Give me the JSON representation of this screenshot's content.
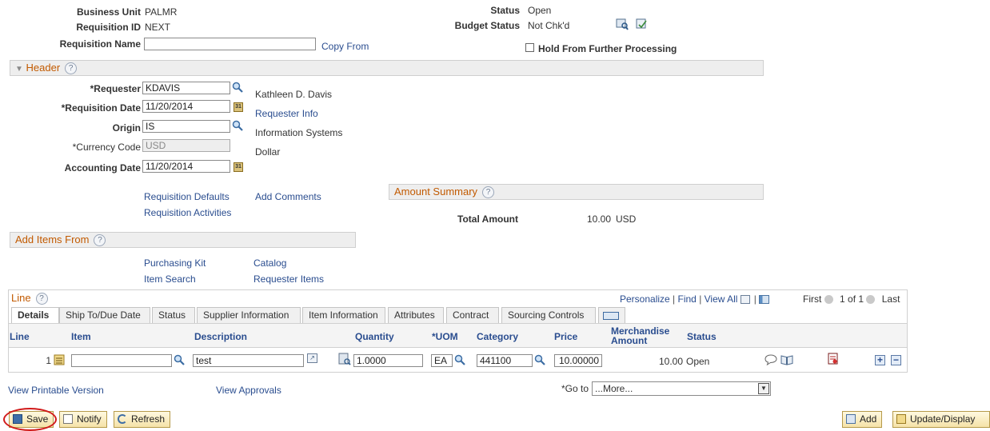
{
  "summary": {
    "business_unit_label": "Business Unit",
    "business_unit_value": "PALMR",
    "requisition_id_label": "Requisition ID",
    "requisition_id_value": "NEXT",
    "requisition_name_label": "Requisition Name",
    "requisition_name_value": "",
    "copy_from_link": "Copy From",
    "status_label": "Status",
    "status_value": "Open",
    "budget_status_label": "Budget Status",
    "budget_status_value": "Not Chk'd",
    "hold_label": "Hold From Further Processing"
  },
  "header": {
    "title": "Header",
    "requester_label": "*Requester",
    "requester_value": "KDAVIS",
    "requester_name": "Kathleen D. Davis",
    "req_date_label": "*Requisition Date",
    "req_date_value": "11/20/2014",
    "requester_info_link": "Requester Info",
    "origin_label": "Origin",
    "origin_value": "IS",
    "origin_desc": "Information Systems",
    "currency_label": "*Currency Code",
    "currency_value": "USD",
    "currency_desc": "Dollar",
    "acct_date_label": "Accounting Date",
    "acct_date_value": "11/20/2014",
    "req_defaults_link": "Requisition Defaults",
    "add_comments_link": "Add Comments",
    "req_activities_link": "Requisition Activities"
  },
  "amount_summary": {
    "title": "Amount Summary",
    "total_label": "Total Amount",
    "total_value": "10.00",
    "currency": "USD"
  },
  "add_items": {
    "title": "Add Items From",
    "purchasing_kit": "Purchasing Kit",
    "catalog": "Catalog",
    "item_search": "Item Search",
    "requester_items": "Requester Items"
  },
  "line_grid": {
    "title": "Line",
    "personalize": "Personalize",
    "find": "Find",
    "view_all": "View All",
    "first": "First",
    "pager": "1 of 1",
    "last": "Last",
    "tabs": [
      "Details",
      "Ship To/Due Date",
      "Status",
      "Supplier Information",
      "Item Information",
      "Attributes",
      "Contract",
      "Sourcing Controls"
    ],
    "columns": [
      "Line",
      "Item",
      "Description",
      "Quantity",
      "*UOM",
      "Category",
      "Price",
      "Merchandise Amount",
      "Status"
    ],
    "rows": [
      {
        "line": "1",
        "item": "",
        "description": "test",
        "quantity": "1.0000",
        "uom": "EA",
        "category": "441100",
        "price": "10.00000",
        "merch_amount": "10.00",
        "status": "Open"
      }
    ]
  },
  "footer": {
    "view_printable": "View Printable Version",
    "view_approvals": "View Approvals",
    "goto_label": "*Go to",
    "goto_value": "...More..."
  },
  "buttons": {
    "save": "Save",
    "notify": "Notify",
    "refresh": "Refresh",
    "add": "Add",
    "update_display": "Update/Display"
  },
  "colors": {
    "section_title": "#c25a00",
    "link": "#2a4d8f",
    "highlight_circle": "#d11a1a"
  }
}
